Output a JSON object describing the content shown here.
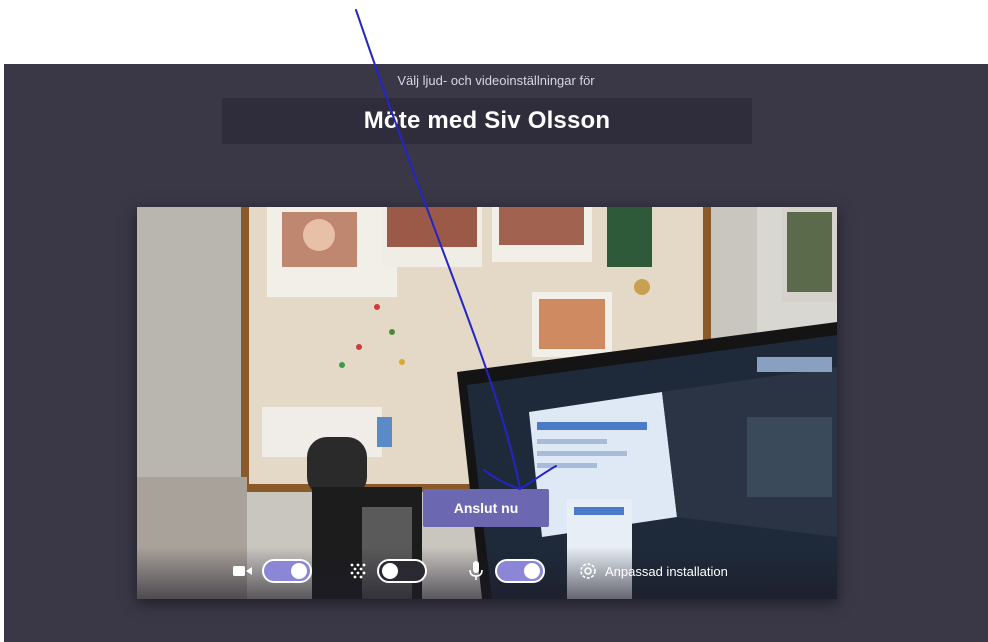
{
  "header": {
    "subtitle": "Välj ljud- och videoinställningar för",
    "meeting_title": "Möte med Siv Olsson"
  },
  "preview": {
    "join_label": "Anslut nu"
  },
  "controls": {
    "camera": {
      "icon": "video-camera-icon",
      "state": "on"
    },
    "blur": {
      "icon": "background-blur-icon",
      "state": "off"
    },
    "microphone": {
      "icon": "microphone-icon",
      "state": "on"
    },
    "custom_setup": {
      "icon": "gear-icon",
      "label": "Anpassad installation"
    }
  },
  "colors": {
    "frame_bg": "#3a3847",
    "title_bar_bg": "#2f2d3b",
    "accent": "#6c67b1",
    "toggle_on": "#8b86d6",
    "annotation_ink": "#2424c8"
  }
}
